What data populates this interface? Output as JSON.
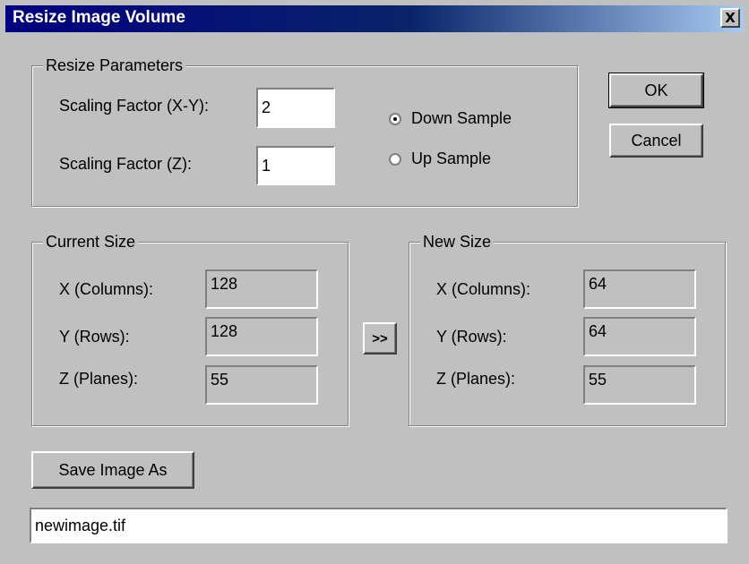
{
  "window": {
    "title": "Resize Image Volume",
    "close_label": "X"
  },
  "resize_params": {
    "group_label": "Resize Parameters",
    "scale_xy_label": "Scaling Factor (X-Y):",
    "scale_xy_value": "2",
    "scale_z_label": "Scaling Factor (Z):",
    "scale_z_value": "1",
    "down_sample_label": "Down Sample",
    "up_sample_label": "Up Sample",
    "selected": "Down Sample"
  },
  "buttons": {
    "ok": "OK",
    "cancel": "Cancel",
    "transfer": ">>",
    "save_as": "Save Image As"
  },
  "current_size": {
    "group_label": "Current Size",
    "x_label": "X (Columns):",
    "x_value": "128",
    "y_label": "Y (Rows):",
    "y_value": "128",
    "z_label": "Z (Planes):",
    "z_value": "55"
  },
  "new_size": {
    "group_label": "New Size",
    "x_label": "X (Columns):",
    "x_value": "64",
    "y_label": "Y (Rows):",
    "y_value": "64",
    "z_label": "Z (Planes):",
    "z_value": "55"
  },
  "filename": {
    "value": "newimage.tif"
  }
}
